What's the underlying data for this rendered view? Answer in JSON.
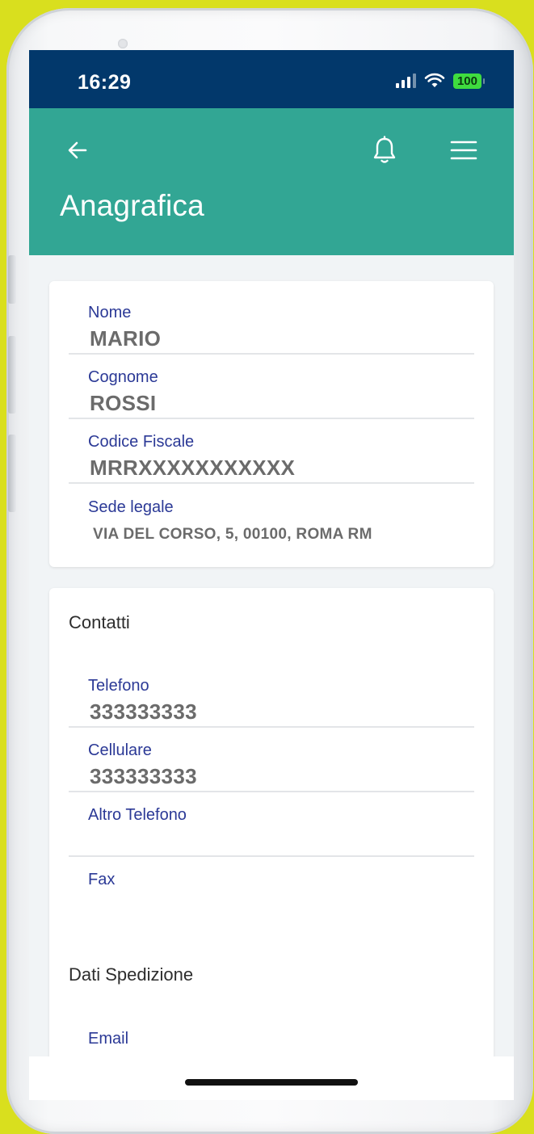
{
  "status_bar": {
    "time": "16:29",
    "battery": "100"
  },
  "header": {
    "title": "Anagrafica",
    "back_icon": "arrow-left-icon",
    "bell_icon": "bell-icon",
    "menu_icon": "hamburger-menu-icon"
  },
  "anagrafica": {
    "fields": [
      {
        "label": "Nome",
        "value": "MARIO"
      },
      {
        "label": "Cognome",
        "value": "ROSSI"
      },
      {
        "label": "Codice Fiscale",
        "value": "MRRXXXXXXXXXXX"
      },
      {
        "label": "Sede legale",
        "value": "VIA DEL CORSO, 5, 00100, ROMA RM"
      }
    ]
  },
  "contatti": {
    "title": "Contatti",
    "fields": [
      {
        "label": "Telefono",
        "value": "333333333"
      },
      {
        "label": "Cellulare",
        "value": "333333333"
      },
      {
        "label": "Altro Telefono",
        "value": ""
      },
      {
        "label": "Fax",
        "value": ""
      }
    ]
  },
  "spedizione": {
    "title": "Dati Spedizione",
    "fields": [
      {
        "label": "Email",
        "value": ""
      }
    ]
  },
  "colors": {
    "status_bar": "#02386b",
    "header": "#32a694",
    "label": "#2b3996",
    "value": "#6b6b6b",
    "frame_background": "#d9df1e"
  }
}
